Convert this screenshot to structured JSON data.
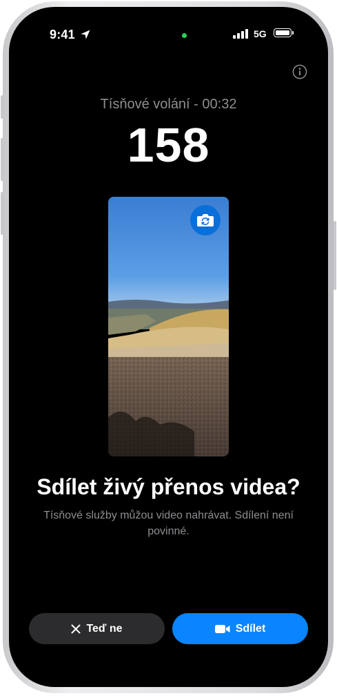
{
  "status_bar": {
    "time": "9:41",
    "network": "5G"
  },
  "call": {
    "status": "Tísňové volání - 00:32",
    "number": "158"
  },
  "prompt": {
    "title": "Sdílet živý přenos videa?",
    "description": "Tísňové služby můžou video nahrávat. Sdílení není povinné."
  },
  "buttons": {
    "decline_label": "Teď ne",
    "share_label": "Sdílet"
  },
  "icons": {
    "location": "location-arrow-icon",
    "info": "info-icon",
    "flip_camera": "camera-flip-icon",
    "close": "close-icon",
    "video": "video-camera-icon"
  },
  "colors": {
    "accent": "#0A84FF",
    "secondary_text": "#8E8E93",
    "background": "#000000",
    "active_indicator": "#30D158"
  }
}
